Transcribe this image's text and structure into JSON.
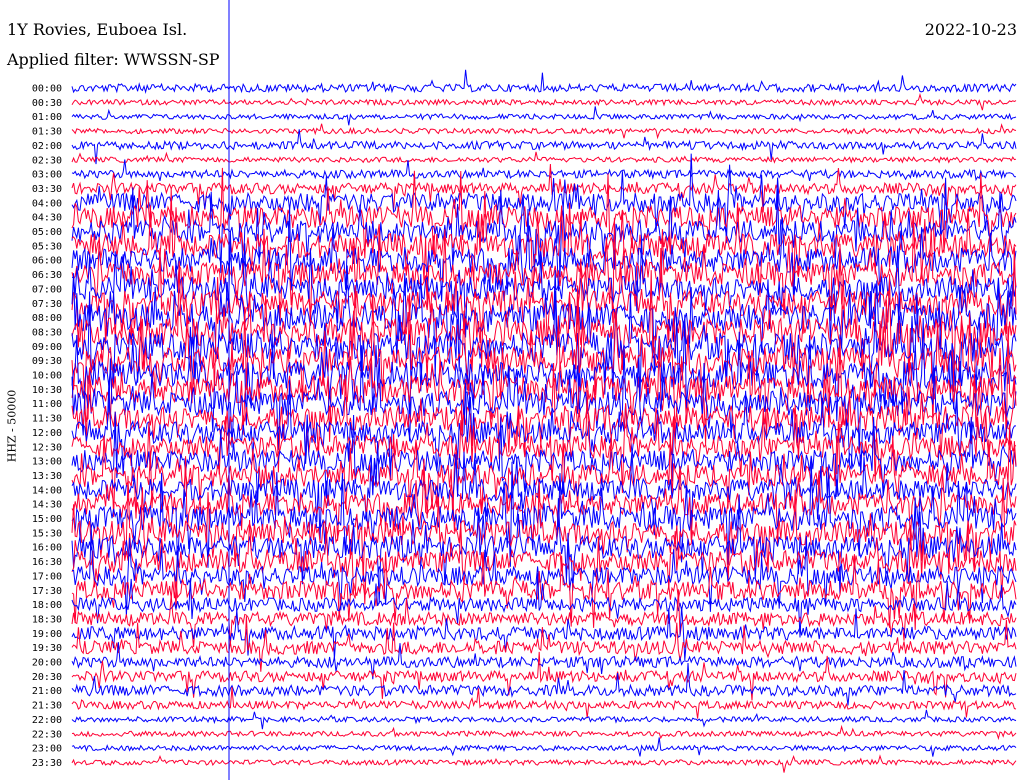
{
  "header": {
    "station": "1Y Rovies, Euboea Isl.",
    "filter": "Applied filter: WWSSN-SP",
    "date": "2022-10-23"
  },
  "chart_data": {
    "type": "line",
    "chart_kind": "helicorder",
    "ylabel": "HHZ - 50000",
    "row_interval_minutes": 30,
    "colors": {
      "even_rows": "#0000ff",
      "odd_rows": "#ff0033"
    },
    "rows": [
      "00:00",
      "00:30",
      "01:00",
      "01:30",
      "02:00",
      "02:30",
      "03:00",
      "03:30",
      "04:00",
      "04:30",
      "05:00",
      "05:30",
      "06:00",
      "06:30",
      "07:00",
      "07:30",
      "08:00",
      "08:30",
      "09:00",
      "09:30",
      "10:00",
      "10:30",
      "11:00",
      "11:30",
      "12:00",
      "12:30",
      "13:00",
      "13:30",
      "14:00",
      "14:30",
      "15:00",
      "15:30",
      "16:00",
      "16:30",
      "17:00",
      "17:30",
      "18:00",
      "18:30",
      "19:00",
      "19:30",
      "20:00",
      "20:30",
      "21:00",
      "21:30",
      "22:00",
      "22:30",
      "23:00",
      "23:30"
    ],
    "relative_noise_level": [
      2,
      1,
      1,
      1,
      2,
      1,
      2,
      3,
      6,
      7,
      7,
      8,
      8,
      8,
      8,
      8,
      9,
      9,
      9,
      9,
      9,
      9,
      8,
      8,
      7,
      7,
      7,
      7,
      7,
      7,
      8,
      8,
      7,
      7,
      6,
      6,
      4,
      4,
      4,
      4,
      3,
      3,
      3,
      2,
      1,
      1,
      1,
      1
    ]
  }
}
